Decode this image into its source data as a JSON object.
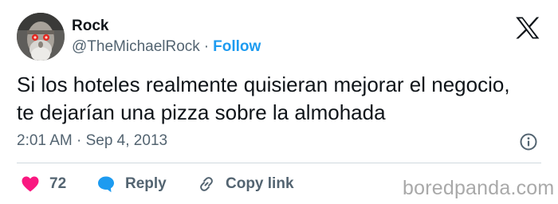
{
  "tweet": {
    "author_name": "Rock",
    "handle": "@TheMichaelRock",
    "separator": "·",
    "follow_label": "Follow",
    "text_lines": [
      "Si los hoteles realmente quisieran mejorar el negocio,",
      "te dejarían una pizza sobre la almohada"
    ],
    "timestamp": "2:01 AM · Sep 4, 2013"
  },
  "actions": {
    "like_count": "72",
    "reply_label": "Reply",
    "copy_link_label": "Copy link"
  },
  "watermark": "boredpanda.com",
  "icons": {
    "platform": "x-logo-icon",
    "info": "info-icon",
    "like": "heart-icon",
    "reply": "speech-bubble-icon",
    "copy": "link-icon"
  },
  "colors": {
    "text": "#0f1419",
    "secondary": "#536471",
    "follow": "#1d9bf0",
    "heart": "#f91880",
    "reply_bubble": "#1d9bf0",
    "divider": "#cfd9de",
    "watermark": "#a9a9a9"
  }
}
